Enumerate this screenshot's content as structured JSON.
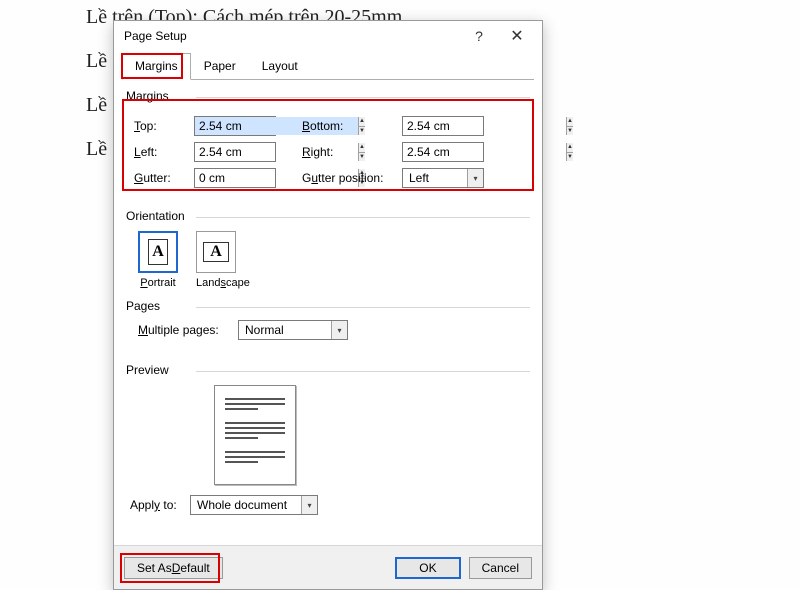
{
  "bg": {
    "line1": "Lề trên (Top): Cách mép trên 20-25mm",
    "le2": "Lề",
    "le3": "Lề",
    "le4": "Lề"
  },
  "dialog": {
    "title": "Page Setup",
    "help": "?",
    "close": "✕"
  },
  "tabs": {
    "margins": "Margins",
    "paper": "Paper",
    "layout": "Layout"
  },
  "sections": {
    "margins": "Margins",
    "orientation": "Orientation",
    "pages": "Pages",
    "preview": "Preview"
  },
  "margins": {
    "topLabel": "Top:",
    "topLabelU": "T",
    "top": "2.54 cm",
    "bottomLabel": "Bottom:",
    "bottom": "2.54 cm",
    "leftLabel": "Left:",
    "left": "2.54 cm",
    "rightLabel": "Right:",
    "right": "2.54 cm",
    "gutterLabel": "Gutter:",
    "gutter": "0 cm",
    "gutterPosLabel": "Gutter position:",
    "gutterPos": "Left"
  },
  "orientation": {
    "portrait": "Portrait",
    "landscape": "Landscape",
    "glyph": "A"
  },
  "pages": {
    "multipleLabel": "Multiple pages:",
    "multiple": "Normal"
  },
  "apply": {
    "label": "Apply to:",
    "value": "Whole document"
  },
  "footer": {
    "setDefault": "Set As Default",
    "ok": "OK",
    "cancel": "Cancel"
  }
}
